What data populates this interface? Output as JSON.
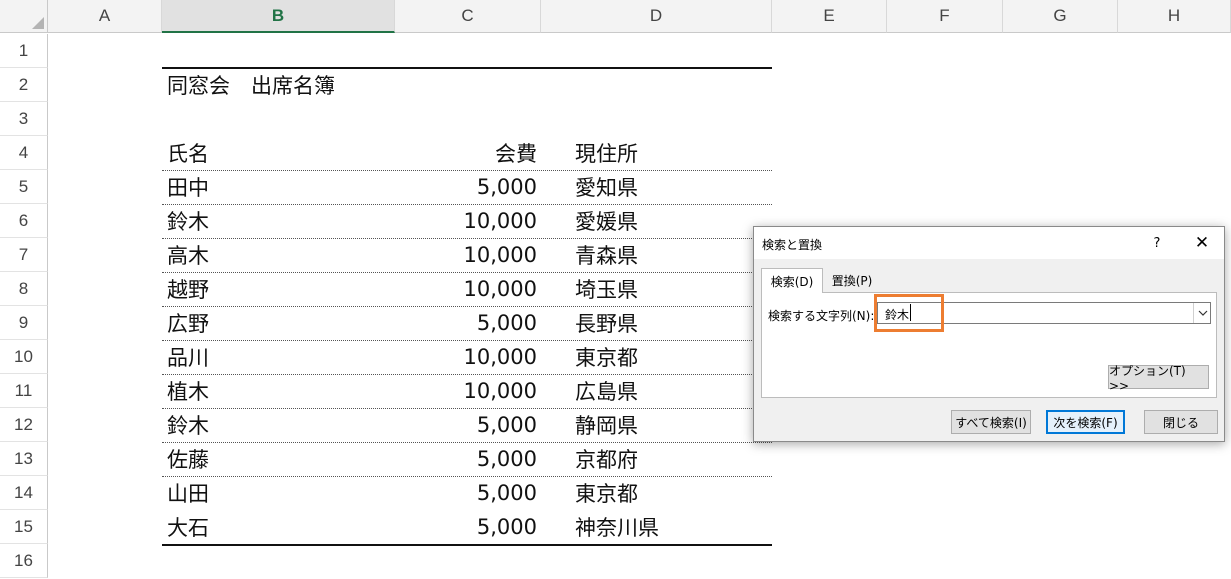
{
  "columns": [
    "A",
    "B",
    "C",
    "D",
    "E",
    "F",
    "G",
    "H"
  ],
  "selected_column": "B",
  "row_numbers": [
    "1",
    "2",
    "3",
    "4",
    "5",
    "6",
    "7",
    "8",
    "9",
    "10",
    "11",
    "12",
    "13",
    "14",
    "15",
    "16"
  ],
  "sheet": {
    "title": "同窓会　出席名簿",
    "headers": {
      "name": "氏名",
      "fee": "会費",
      "address": "現住所"
    },
    "rows": [
      {
        "name": "田中",
        "fee": "5,000",
        "address": "愛知県"
      },
      {
        "name": "鈴木",
        "fee": "10,000",
        "address": "愛媛県"
      },
      {
        "name": "高木",
        "fee": "10,000",
        "address": "青森県"
      },
      {
        "name": "越野",
        "fee": "10,000",
        "address": "埼玉県"
      },
      {
        "name": "広野",
        "fee": "5,000",
        "address": "長野県"
      },
      {
        "name": "品川",
        "fee": "10,000",
        "address": "東京都"
      },
      {
        "name": "植木",
        "fee": "10,000",
        "address": "広島県"
      },
      {
        "name": "鈴木",
        "fee": "5,000",
        "address": "静岡県"
      },
      {
        "name": "佐藤",
        "fee": "5,000",
        "address": "京都府"
      },
      {
        "name": "山田",
        "fee": "5,000",
        "address": "東京都"
      },
      {
        "name": "大石",
        "fee": "5,000",
        "address": "神奈川県"
      }
    ]
  },
  "dialog": {
    "title": "検索と置換",
    "help": "?",
    "close": "✕",
    "tabs": {
      "find": "検索(D)",
      "replace": "置換(P)"
    },
    "find_label": "検索する文字列(N):",
    "find_value": "鈴木",
    "dropdown_icon": "chevron-down-icon",
    "options_button": "オプション(T) >>",
    "find_all_button": "すべて検索(I)",
    "find_next_button": "次を検索(F)",
    "close_button": "閉じる",
    "highlight_color": "#ed7d31"
  }
}
